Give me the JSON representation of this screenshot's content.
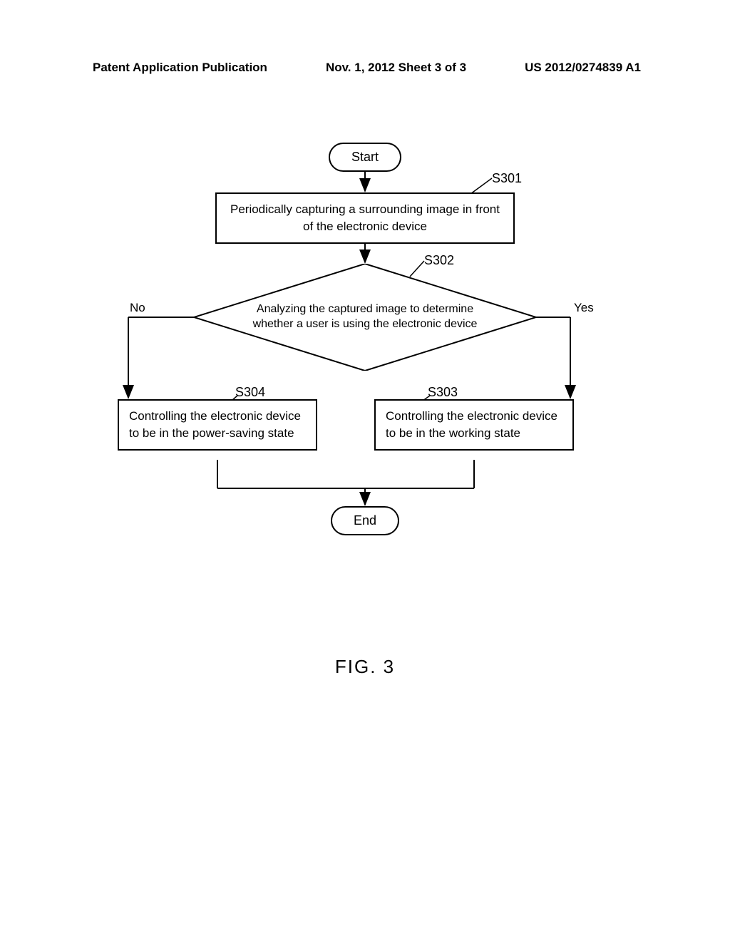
{
  "header": {
    "left": "Patent Application Publication",
    "center": "Nov. 1, 2012  Sheet 3 of 3",
    "right": "US 2012/0274839 A1"
  },
  "flowchart": {
    "start": "Start",
    "end": "End",
    "capture": "Periodically capturing a surrounding image in front of the electronic device",
    "decision": "Analyzing the captured image to determine whether a user is using the electronic device",
    "saving": "Controlling the electronic device to be in the power-saving state",
    "working": "Controlling the electronic device to be in the working state",
    "labels": {
      "s301": "S301",
      "s302": "S302",
      "s303": "S303",
      "s304": "S304",
      "no": "No",
      "yes": "Yes"
    }
  },
  "figure_label": "FIG. 3"
}
